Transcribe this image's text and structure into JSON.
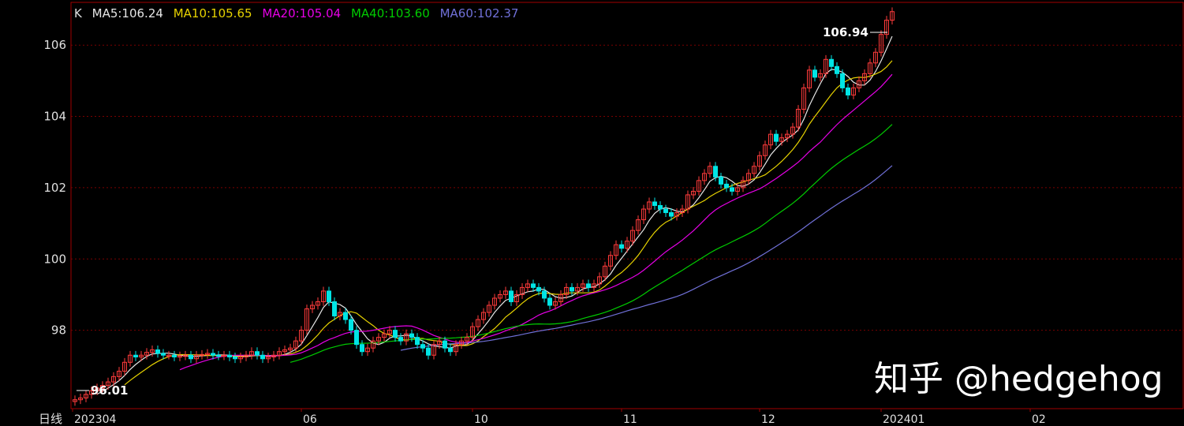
{
  "legend": {
    "k_label": "K",
    "ma5": "MA5:106.24",
    "ma10": "MA10:105.65",
    "ma20": "MA20:105.04",
    "ma40": "MA40:103.60",
    "ma60": "MA60:102.37"
  },
  "period_label": "日线",
  "watermark": "知乎 @hedgehog",
  "colors": {
    "background": "#000000",
    "up": "#ff3b3b",
    "down": "#00e5e5",
    "ma5": "#e6e6e6",
    "ma10": "#e6d200",
    "ma20": "#e600e6",
    "ma40": "#00cc00",
    "ma60": "#7070d8",
    "grid": "#7a0000",
    "axis_text": "#e0e0e0"
  },
  "chart_data": {
    "type": "candlestick",
    "y_ticks": [
      "98",
      "100",
      "102",
      "104",
      "106"
    ],
    "ylim": [
      95.8,
      107.2
    ],
    "x_ticks": [
      {
        "label": "202304",
        "index": 0
      },
      {
        "label": "06",
        "index": 41
      },
      {
        "label": "10",
        "index": 72
      },
      {
        "label": "11",
        "index": 99
      },
      {
        "label": "12",
        "index": 124
      },
      {
        "label": "202401",
        "index": 146
      },
      {
        "label": "02",
        "index": 173
      }
    ],
    "close": [
      96.05,
      96.1,
      96.2,
      96.3,
      96.38,
      96.45,
      96.55,
      96.7,
      96.85,
      97.1,
      97.3,
      97.25,
      97.3,
      97.38,
      97.45,
      97.35,
      97.3,
      97.3,
      97.25,
      97.28,
      97.3,
      97.2,
      97.3,
      97.32,
      97.35,
      97.3,
      97.28,
      97.3,
      97.25,
      97.2,
      97.25,
      97.3,
      97.4,
      97.3,
      97.2,
      97.25,
      97.3,
      97.4,
      97.45,
      97.5,
      97.7,
      98.0,
      98.6,
      98.7,
      98.8,
      99.1,
      98.8,
      98.4,
      98.5,
      98.3,
      98.0,
      97.6,
      97.4,
      97.5,
      97.7,
      97.8,
      97.9,
      98.0,
      97.8,
      97.7,
      97.9,
      97.8,
      97.6,
      97.5,
      97.3,
      97.6,
      97.7,
      97.5,
      97.4,
      97.6,
      97.7,
      97.8,
      98.1,
      98.3,
      98.5,
      98.7,
      98.9,
      99.0,
      99.1,
      98.8,
      99.0,
      99.2,
      99.3,
      99.2,
      99.1,
      98.9,
      98.7,
      98.8,
      99.0,
      99.2,
      99.1,
      99.2,
      99.3,
      99.2,
      99.3,
      99.5,
      99.8,
      100.1,
      100.4,
      100.3,
      100.5,
      100.8,
      101.1,
      101.4,
      101.6,
      101.5,
      101.4,
      101.3,
      101.2,
      101.3,
      101.4,
      101.8,
      101.9,
      102.2,
      102.4,
      102.6,
      102.3,
      102.1,
      102.0,
      101.9,
      102.0,
      102.2,
      102.4,
      102.6,
      102.9,
      103.2,
      103.5,
      103.3,
      103.4,
      103.5,
      103.7,
      104.2,
      104.8,
      105.3,
      105.1,
      105.2,
      105.6,
      105.4,
      105.2,
      104.8,
      104.6,
      104.8,
      105.0,
      105.2,
      105.5,
      105.8,
      106.3,
      106.7,
      106.94
    ],
    "ma_legend": {
      "ma5": 106.24,
      "ma10": 105.65,
      "ma20": 105.04,
      "ma40": 103.6,
      "ma60": 102.37
    },
    "annotations": {
      "last_close": "106.94",
      "period_low": "96.01"
    },
    "grid": true
  }
}
